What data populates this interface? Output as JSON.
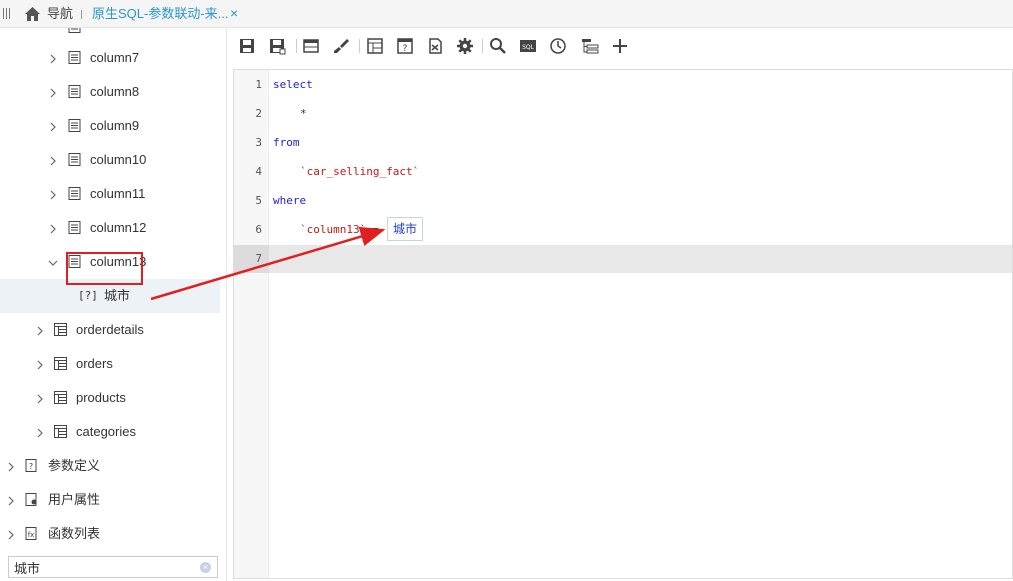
{
  "tabbar": {
    "nav_label": "导航",
    "active_tab_label": "原生SQL-参数联动-来...",
    "close_label": "×"
  },
  "tree": {
    "columns": [
      {
        "label": "column7"
      },
      {
        "label": "column8"
      },
      {
        "label": "column9"
      },
      {
        "label": "column10"
      },
      {
        "label": "column11"
      },
      {
        "label": "column12"
      },
      {
        "label": "column13"
      }
    ],
    "parameter_prefix": "[?]",
    "parameter_label": "城市",
    "tables": [
      {
        "label": "orderdetails"
      },
      {
        "label": "orders"
      },
      {
        "label": "products"
      },
      {
        "label": "categories"
      }
    ],
    "sections": [
      {
        "label": "参数定义",
        "icon": "param-definition-icon"
      },
      {
        "label": "用户属性",
        "icon": "user-attribute-icon"
      },
      {
        "label": "函数列表",
        "icon": "function-list-icon"
      }
    ]
  },
  "search": {
    "value": "城市",
    "clear_label": "×"
  },
  "toolbar": {
    "icons": [
      "save-icon",
      "save-as-icon",
      "table-icon",
      "brush-icon",
      "grid-icon",
      "help-icon",
      "export-icon",
      "gear-icon",
      "search-icon",
      "sql-icon",
      "clock-icon",
      "tree-icon",
      "plus-icon"
    ]
  },
  "editor": {
    "line_numbers": [
      "1",
      "2",
      "3",
      "4",
      "5",
      "6",
      "7"
    ],
    "line1": "select",
    "line2": "*",
    "line3": "from",
    "line4": "`car_selling_fact`",
    "line5": "where",
    "line6_column": "`column13`",
    "line6_op": "=",
    "param_chip": "城市"
  },
  "colors": {
    "accent": "#2996cf",
    "keyword": "#1f1fcc",
    "string": "#c41a16",
    "annotation_red": "#e02020"
  }
}
